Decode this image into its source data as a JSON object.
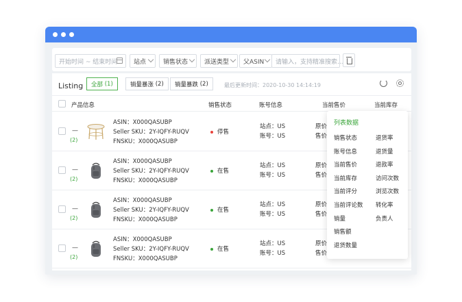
{
  "filters": {
    "date_range": "开始时间 ~ 结束时间",
    "site": "站点",
    "sale_status": "销售状态",
    "delivery_type": "派送类型",
    "parent_asin": "父ASIN",
    "search_placeholder": "请输入，支持精准搜索..."
  },
  "listing": {
    "title": "Listing",
    "tabs": [
      {
        "label": "全部",
        "count": "(1)"
      },
      {
        "label": "销量暴涨",
        "count": "(2)"
      },
      {
        "label": "销量暴跌",
        "count": "(2)"
      }
    ],
    "last_updated": "最后更新时间：2020-10-30 14:14:19"
  },
  "table": {
    "headers": [
      "产品信息",
      "销售状态",
      "账号信息",
      "当前售价",
      "当前库存"
    ],
    "rows": [
      {
        "dash": "—",
        "count": "(2)",
        "thumb": "table-icon",
        "asin": "ASIN：X000QASUBP",
        "sku": "Seller SKU：2Y-IQFY-RUQV",
        "fnsku": "FNSKU：X000QASUBP",
        "status": "停售",
        "status_color": "#e8423b",
        "site": "站点：US",
        "account": "账号：US",
        "price1": "原价",
        "price2": "售价"
      },
      {
        "dash": "—",
        "count": "(2)",
        "thumb": "backpack-icon",
        "asin": "ASIN：X000QASUBP",
        "sku": "Seller SKU：2Y-IQFY-RUQV",
        "fnsku": "FNSKU：X000QASUBP",
        "status": "在售",
        "status_color": "#3aa53a",
        "site": "站点：US",
        "account": "账号：US",
        "price1": "原价",
        "price2": "售价"
      },
      {
        "dash": "—",
        "count": "(2)",
        "thumb": "backpack-icon",
        "asin": "ASIN：X000QASUBP",
        "sku": "Seller SKU：2Y-IQFY-RUQV",
        "fnsku": "FNSKU：X000QASUBP",
        "status": "在售",
        "status_color": "#3aa53a",
        "site": "站点：US",
        "account": "账号：US",
        "price1": "原价",
        "price2": "售价"
      },
      {
        "dash": "—",
        "count": "(2)",
        "thumb": "backpack-icon",
        "asin": "ASIN：X000QASUBP",
        "sku": "Seller SKU：2Y-IQFY-RUQV",
        "fnsku": "FNSKU：X000QASUBP",
        "status": "在售",
        "status_color": "#3aa53a",
        "site": "站点：US",
        "account": "账号：US",
        "price1": "原价",
        "price2": "售价"
      }
    ]
  },
  "column_menu": {
    "title": "列表数据",
    "left": [
      "销售状态",
      "账号信息",
      "当前售价",
      "当前库存",
      "当前评分",
      "当前评论数",
      "销量",
      "销售额",
      "退货数量"
    ],
    "right": [
      "退货率",
      "退货量",
      "退款率",
      "访问次数",
      "浏览次数",
      "转化率",
      "负责人"
    ]
  },
  "colors": {
    "titlebar": "#4a86f2",
    "accent_green": "#3aa53a",
    "stopped_red": "#e8423b"
  }
}
